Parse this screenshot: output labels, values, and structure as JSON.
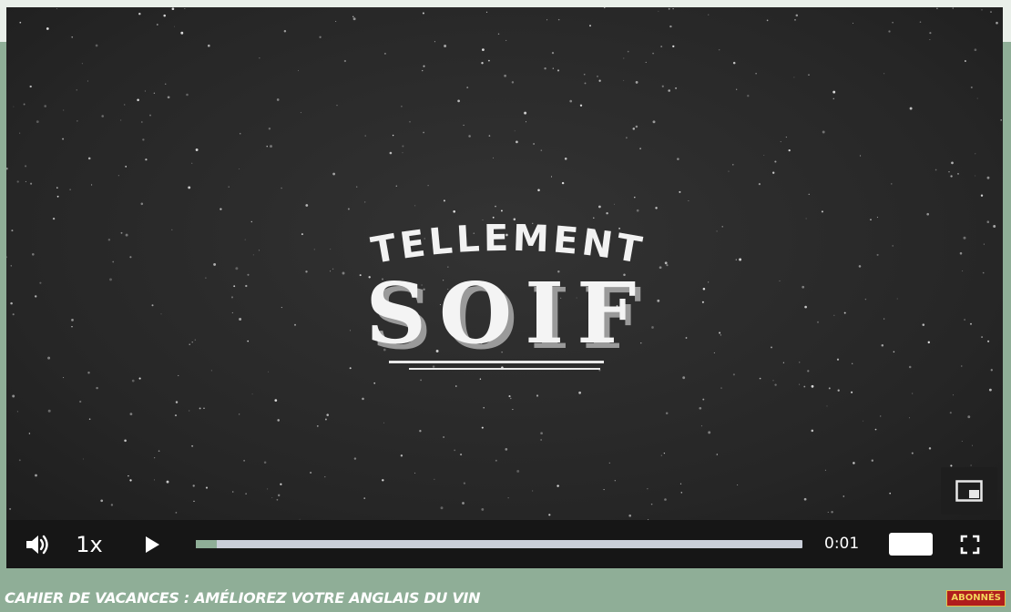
{
  "video": {
    "logo_line1": "TELLEMENT",
    "logo_line2": "SOIF"
  },
  "controls": {
    "speed_label": "1x",
    "time": "0:01",
    "progress": 0.035
  },
  "caption": {
    "title": "CAHIER DE VACANCES : AMÉLIOREZ VOTRE ANGLAIS DU VIN",
    "badge": "ABONNÉS"
  },
  "icons": {
    "volume": "speaker-icon",
    "play": "play-icon",
    "pip": "picture-in-picture-icon",
    "fullscreen": "fullscreen-icon"
  },
  "colors": {
    "page_bg": "#8fae97",
    "player_bg": "#2a2a2a",
    "progress_track": "#c9ced8",
    "progress_fill": "#8fae97",
    "badge_bg": "#b01d1d",
    "badge_text": "#f4d55c"
  }
}
